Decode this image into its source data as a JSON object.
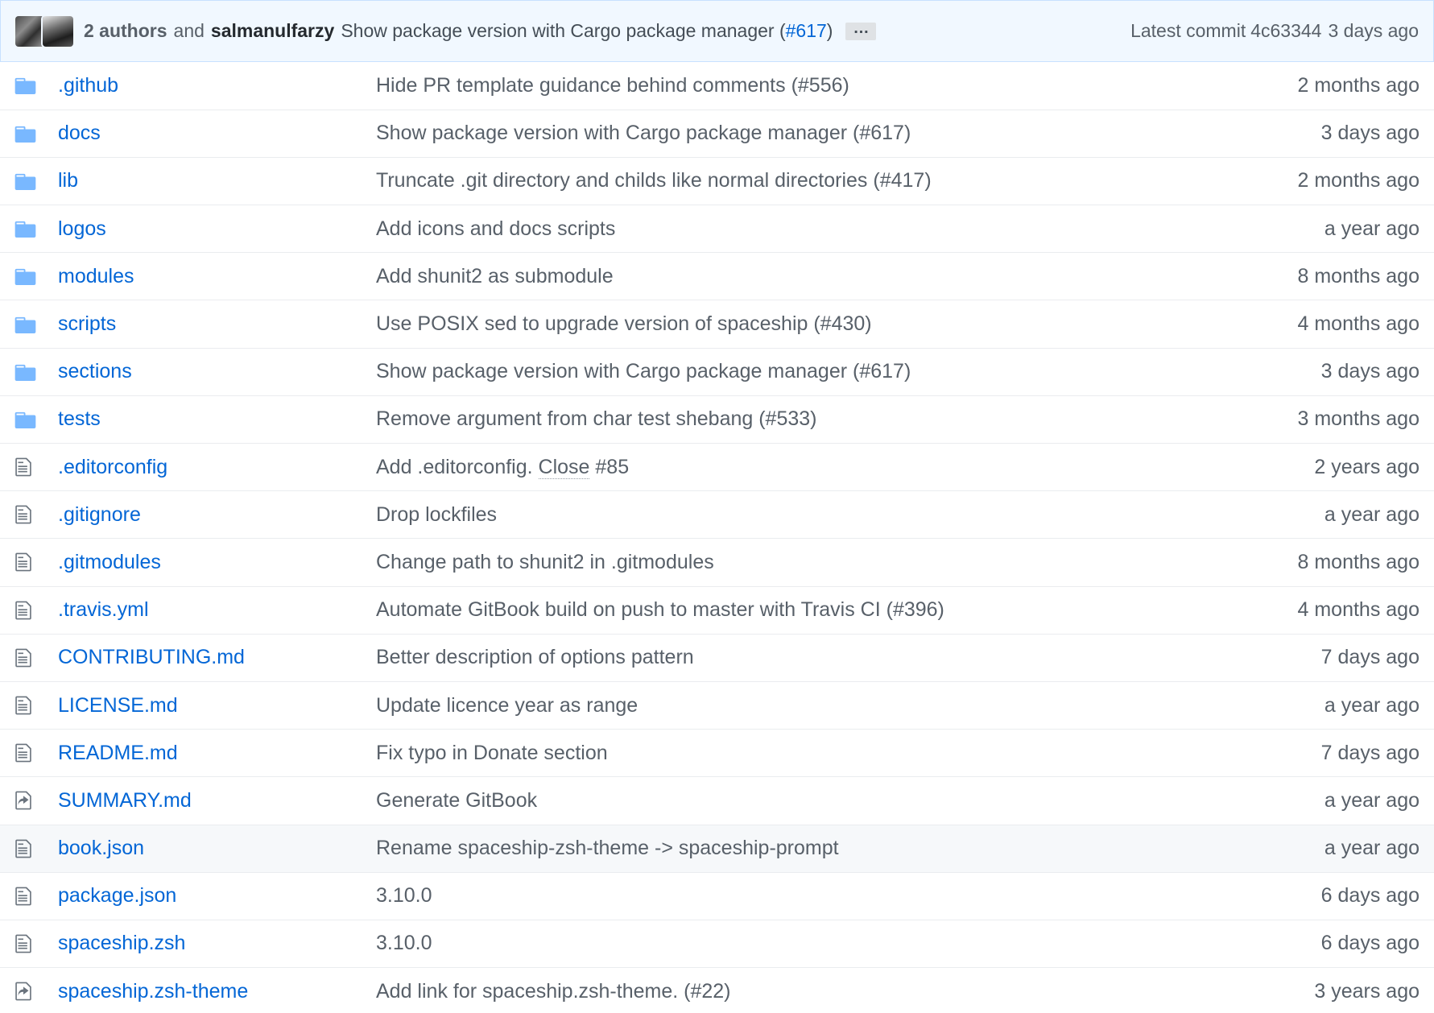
{
  "commit_tease": {
    "authors_label": "2 authors",
    "and_label": "and",
    "author": "salmanulfarzy",
    "message": "Show package version with Cargo package manager (",
    "pr_ref": "#617",
    "message_end": ")",
    "ellipsis": "…",
    "latest_label": "Latest commit",
    "sha": "4c63344",
    "time": "3 days ago"
  },
  "files": [
    {
      "name": ".github",
      "type": "folder",
      "message": "Hide PR template guidance behind comments (#556)",
      "age": "2 months ago"
    },
    {
      "name": "docs",
      "type": "folder",
      "message": "Show package version with Cargo package manager (#617)",
      "age": "3 days ago"
    },
    {
      "name": "lib",
      "type": "folder",
      "message": "Truncate .git directory and childs like normal directories (#417)",
      "age": "2 months ago"
    },
    {
      "name": "logos",
      "type": "folder",
      "message": "Add icons and docs scripts",
      "age": "a year ago"
    },
    {
      "name": "modules",
      "type": "folder",
      "message": "Add shunit2 as submodule",
      "age": "8 months ago"
    },
    {
      "name": "scripts",
      "type": "folder",
      "message": "Use POSIX sed to upgrade version of spaceship (#430)",
      "age": "4 months ago"
    },
    {
      "name": "sections",
      "type": "folder",
      "message": "Show package version with Cargo package manager (#617)",
      "age": "3 days ago"
    },
    {
      "name": "tests",
      "type": "folder",
      "message": "Remove argument from char test shebang (#533)",
      "age": "3 months ago"
    },
    {
      "name": ".editorconfig",
      "type": "file",
      "message": "Add .editorconfig.",
      "message_link": "Close",
      "message_tail": "#85",
      "age": "2 years ago"
    },
    {
      "name": ".gitignore",
      "type": "file",
      "message": "Drop lockfiles",
      "age": "a year ago"
    },
    {
      "name": ".gitmodules",
      "type": "file",
      "message": "Change path to shunit2 in .gitmodules",
      "age": "8 months ago"
    },
    {
      "name": ".travis.yml",
      "type": "file",
      "message": "Automate GitBook build on push to master with Travis CI (#396)",
      "age": "4 months ago"
    },
    {
      "name": "CONTRIBUTING.md",
      "type": "file",
      "message": "Better description of options pattern",
      "age": "7 days ago"
    },
    {
      "name": "LICENSE.md",
      "type": "file",
      "message": "Update licence year as range",
      "age": "a year ago"
    },
    {
      "name": "README.md",
      "type": "file",
      "message": "Fix typo in Donate section",
      "age": "7 days ago"
    },
    {
      "name": "SUMMARY.md",
      "type": "symlink",
      "message": "Generate GitBook",
      "age": "a year ago"
    },
    {
      "name": "book.json",
      "type": "file",
      "message": "Rename spaceship-zsh-theme -> spaceship-prompt",
      "age": "a year ago",
      "highlighted": true
    },
    {
      "name": "package.json",
      "type": "file",
      "message": "3.10.0",
      "age": "6 days ago"
    },
    {
      "name": "spaceship.zsh",
      "type": "file",
      "message": "3.10.0",
      "age": "6 days ago"
    },
    {
      "name": "spaceship.zsh-theme",
      "type": "symlink",
      "message": "Add link for spaceship.zsh-theme. (#22)",
      "age": "3 years ago"
    }
  ],
  "colors": {
    "link": "#0366d6",
    "muted": "#586069",
    "folder_icon": "#79b8ff",
    "file_icon": "#6a737d",
    "tease_bg": "#f1f8ff"
  },
  "icons": {
    "folder": "folder-icon",
    "file": "file-text-icon",
    "symlink": "file-symlink-icon"
  }
}
